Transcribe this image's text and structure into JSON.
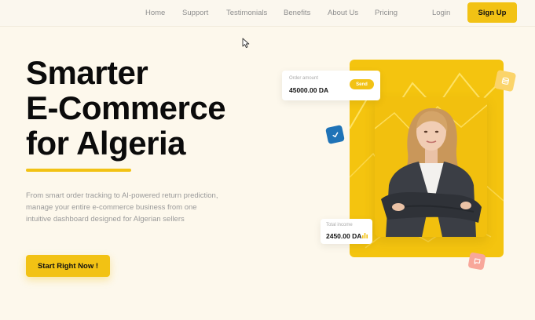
{
  "nav": {
    "links": [
      "Home",
      "Support",
      "Testimonials",
      "Benefits",
      "About Us",
      "Pricing"
    ],
    "login": "Login",
    "signup": "Sign Up"
  },
  "hero": {
    "title_lines": [
      "Smarter",
      "E-Commerce",
      "for Algeria"
    ],
    "description": "From smart order tracking to AI-powered return prediction, manage your entire e-commerce business from one intuitive dashboard designed for Algerian sellers",
    "cta": "Start Right Now !"
  },
  "order_card": {
    "label": "Order amount",
    "value": "45000.00 DA",
    "button": "Send"
  },
  "income_card": {
    "label": "Total income",
    "value": "2450.00 DA"
  },
  "colors": {
    "accent": "#f2c214",
    "background": "#fdf8ec",
    "check_badge": "#1f73b7",
    "chat_badge": "#f8a79a",
    "db_badge": "#fbd46a"
  },
  "icons": [
    "mouse-pointer-icon",
    "database-icon",
    "check-icon",
    "chat-icon",
    "bar-chart-icon"
  ]
}
